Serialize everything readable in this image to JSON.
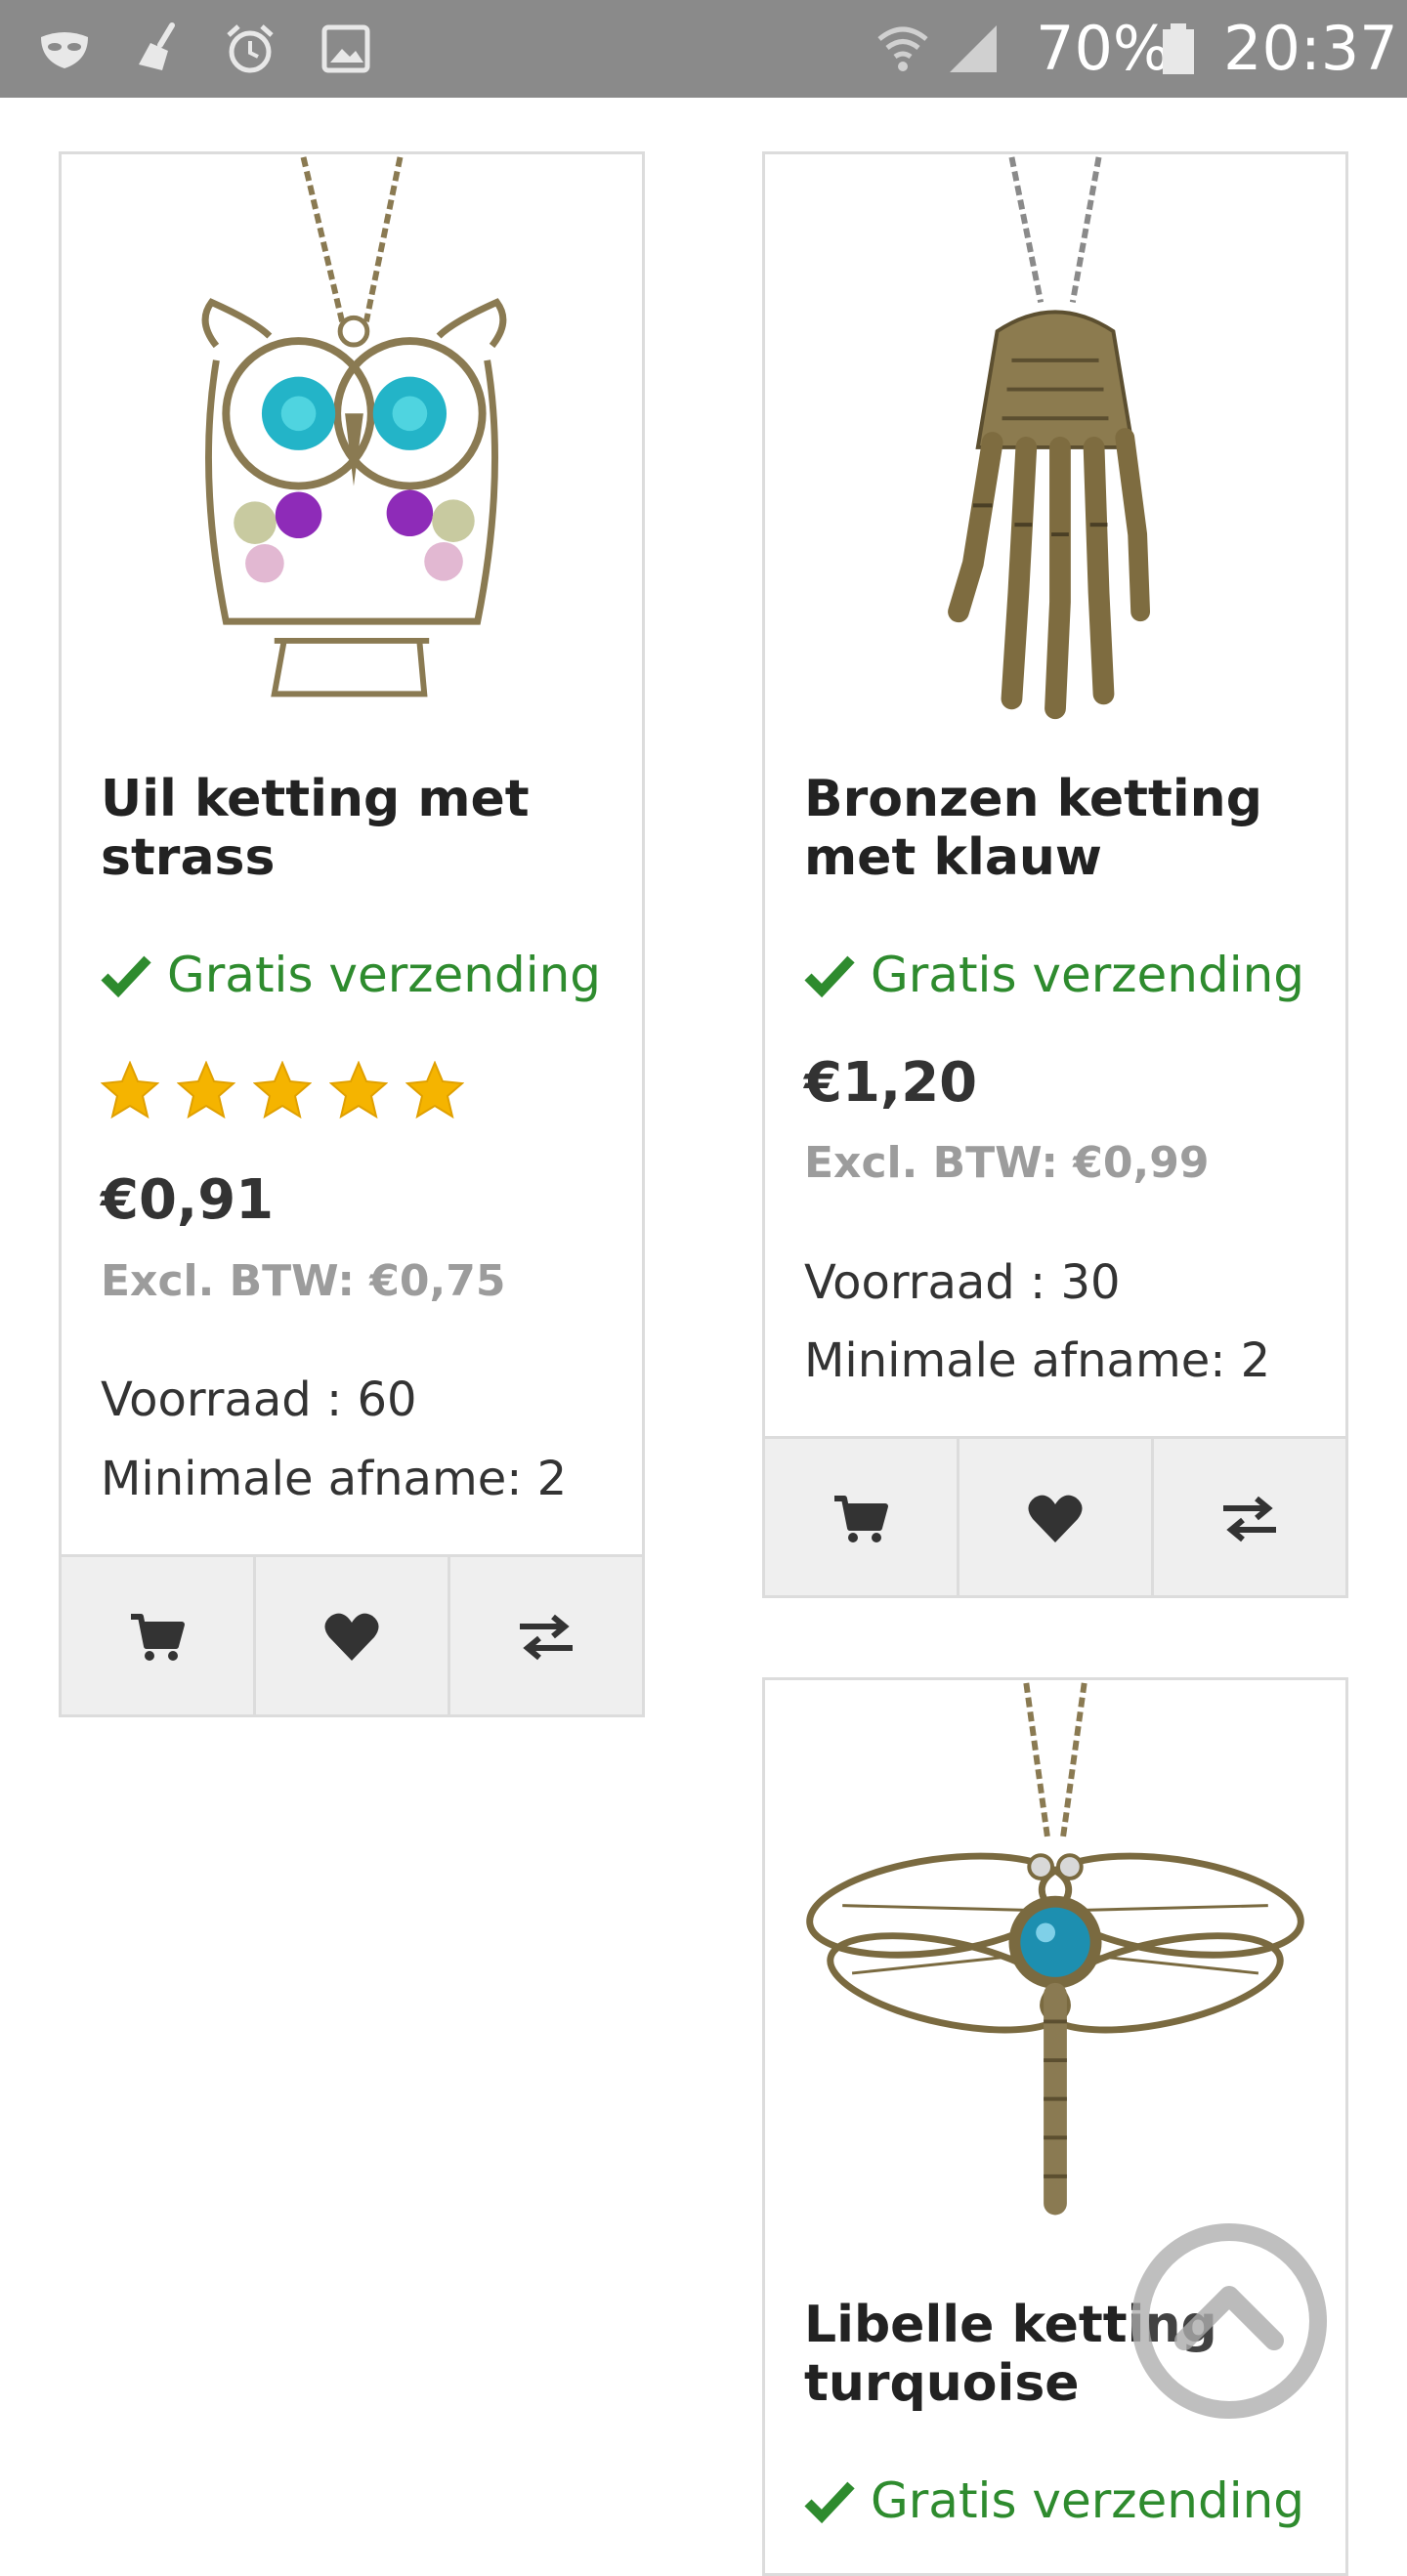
{
  "status_bar": {
    "battery": "70%",
    "time": "20:37",
    "icons": [
      "mask-icon",
      "broom-icon",
      "alarm-icon",
      "image-icon",
      "wifi-icon",
      "signal-icon",
      "battery-icon"
    ]
  },
  "colors": {
    "accent_green": "#2e8b2e",
    "star": "#f5b400",
    "price": "#333333",
    "muted": "#9c9c9c",
    "border": "#dcdcdc",
    "action_bg": "#efefef"
  },
  "products": [
    {
      "title": "Uil ketting met strass",
      "shipping": "Gratis verzending",
      "rating": 5,
      "price": "€0,91",
      "excl_btw": "Excl. BTW: €0,75",
      "stock": "Voorraad : 60",
      "min_order": "Minimale afname: 2",
      "image": "owl-necklace-image"
    },
    {
      "title": "Bronzen ketting met klauw",
      "shipping": "Gratis verzending",
      "price": "€1,20",
      "excl_btw": "Excl. BTW: €0,99",
      "stock": "Voorraad : 30",
      "min_order": "Minimale afname: 2",
      "image": "claw-necklace-image"
    },
    {
      "title": "Libelle ketting turquoise",
      "shipping": "Gratis verzending",
      "image": "dragonfly-necklace-image"
    }
  ],
  "actions": [
    "cart-icon",
    "heart-icon",
    "compare-icon"
  ]
}
